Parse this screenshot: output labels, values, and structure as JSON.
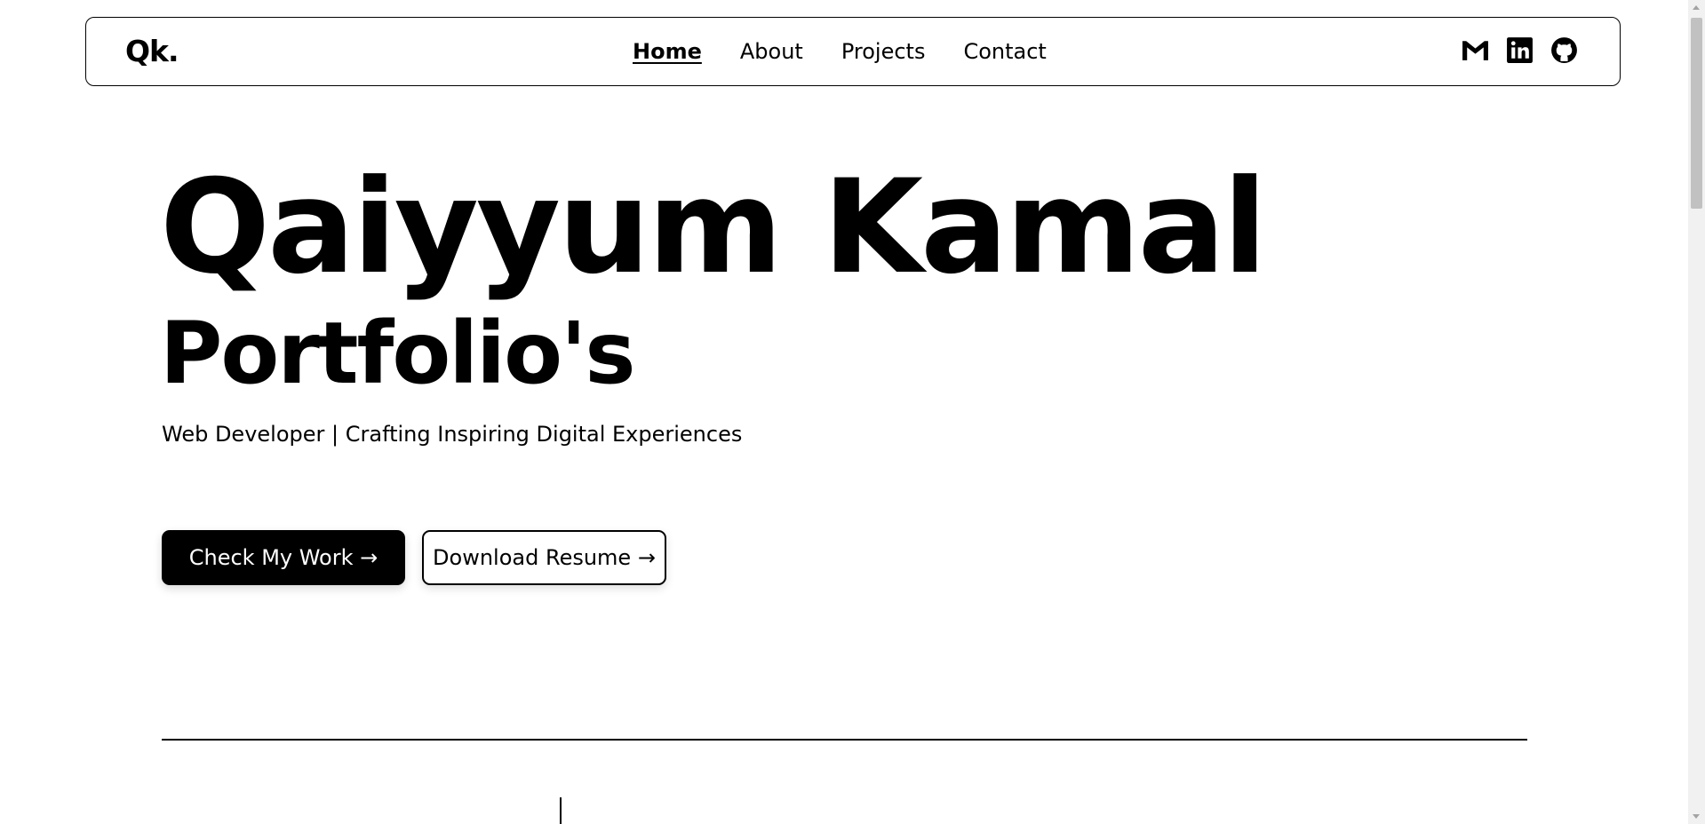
{
  "nav": {
    "logo": "Qk.",
    "links": [
      {
        "label": "Home",
        "active": true
      },
      {
        "label": "About",
        "active": false
      },
      {
        "label": "Projects",
        "active": false
      },
      {
        "label": "Contact",
        "active": false
      }
    ],
    "socials": [
      "gmail-icon",
      "linkedin-icon",
      "github-icon"
    ]
  },
  "hero": {
    "name": "Qaiyyum Kamal",
    "subtitle": "Portfolio's",
    "tagline": "Web Developer | Crafting Inspiring Digital Experiences",
    "primary_button": "Check My Work →",
    "secondary_button": "Download Resume →"
  },
  "colors": {
    "text": "#000000",
    "background": "#ffffff",
    "primary_button_bg": "#000000",
    "primary_button_text": "#ffffff"
  }
}
